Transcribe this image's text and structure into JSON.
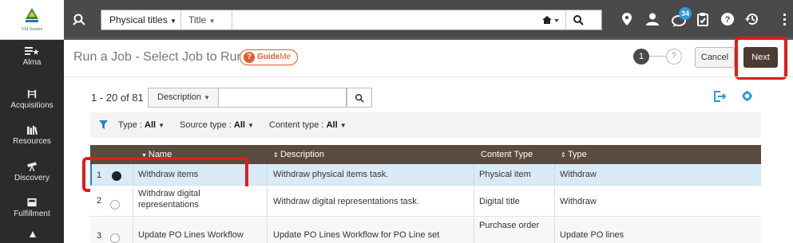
{
  "sidebar": {
    "logo_text": "Vid Seattre",
    "items": [
      {
        "label": "Alma"
      },
      {
        "label": "Acquisitions"
      },
      {
        "label": "Resources"
      },
      {
        "label": "Discovery"
      },
      {
        "label": "Fulfillment"
      }
    ]
  },
  "topbar": {
    "search_type": "Physical titles",
    "search_field": "Title",
    "notification_count": "34"
  },
  "header": {
    "title": "Run a Job - Select Job to Run",
    "guideme_q": "?",
    "guideme_guide": "Guide",
    "guideme_me": "Me",
    "step1": "1",
    "step2": "?",
    "cancel": "Cancel",
    "next": "Next"
  },
  "toolbar": {
    "count": "1 - 20 of 81",
    "search_scope": "Description"
  },
  "filters": {
    "type_label": "Type :",
    "type_value": "All",
    "source_label": "Source type :",
    "source_value": "All",
    "content_label": "Content type :",
    "content_value": "All"
  },
  "table": {
    "columns": [
      "Name",
      "Description",
      "Content Type",
      "Type"
    ],
    "rows": [
      {
        "num": "1",
        "selected": true,
        "name": "Withdraw items",
        "description": "Withdraw physical items task.",
        "content_type": "Physical item",
        "type": "Withdraw"
      },
      {
        "num": "2",
        "selected": false,
        "name": "Withdraw digital representations",
        "description": "Withdraw digital representations task.",
        "content_type": "Digital title",
        "type": "Withdraw"
      },
      {
        "num": "3",
        "selected": false,
        "name": "Update PO Lines Workflow",
        "description": "Update PO Lines Workflow for PO Line set",
        "content_type": "Purchase order",
        "type": "Update PO lines"
      }
    ]
  },
  "colors": {
    "topbar": "#4a4a4a",
    "sidebar": "#2b2b2b",
    "table_header": "#5b4a3e",
    "selected_row": "#d9ebf8",
    "accent_blue": "#2e9ad8",
    "highlight_red": "#e01b1b",
    "guideme_orange": "#e25b2a"
  }
}
